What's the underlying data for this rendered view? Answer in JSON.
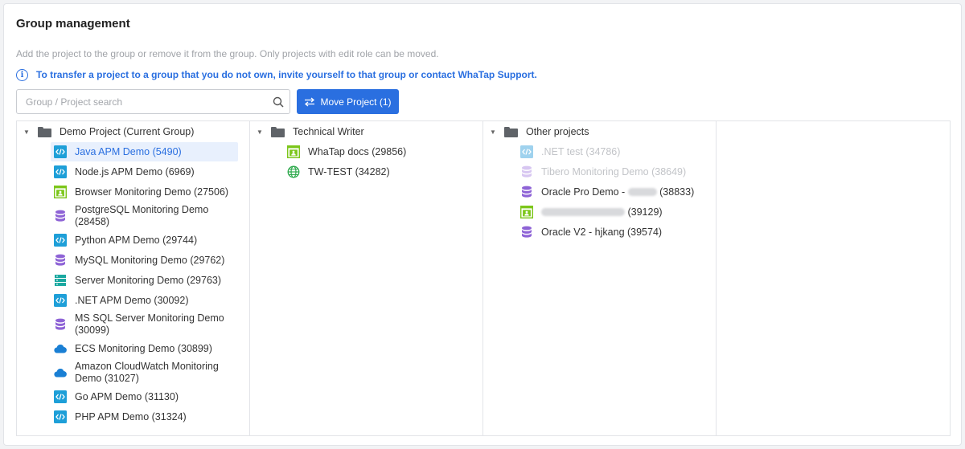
{
  "page": {
    "title": "Group management",
    "description": "Add the project to the group or remove it from the group. Only projects with edit role can be moved.",
    "info_text": "To transfer a project to a group that you do not own, invite yourself to that group or contact WhaTap Support."
  },
  "search": {
    "placeholder": "Group / Project search",
    "value": ""
  },
  "move_button": {
    "label": "Move Project (1)"
  },
  "colors": {
    "accent": "#2a6fe0",
    "apm": "#1e9fd8",
    "browser": "#7cc61a",
    "db": "#8e63d6",
    "server": "#1aa8a0",
    "cloud": "#1a7fd4"
  },
  "groups": [
    {
      "name": "Demo Project (Current Group)",
      "items": [
        {
          "label": "Java APM Demo (5490)",
          "icon": "apm-code-icon",
          "selected": true
        },
        {
          "label": "Node.js APM Demo (6969)",
          "icon": "apm-code-icon"
        },
        {
          "label": "Browser Monitoring Demo (27506)",
          "icon": "browser-monitoring-icon"
        },
        {
          "label": "PostgreSQL Monitoring Demo (28458)",
          "icon": "database-icon"
        },
        {
          "label": "Python APM Demo (29744)",
          "icon": "apm-code-icon"
        },
        {
          "label": "MySQL Monitoring Demo (29762)",
          "icon": "database-icon"
        },
        {
          "label": "Server Monitoring Demo (29763)",
          "icon": "server-icon"
        },
        {
          "label": ".NET APM Demo (30092)",
          "icon": "apm-code-icon"
        },
        {
          "label": "MS SQL Server Monitoring Demo (30099)",
          "icon": "database-icon"
        },
        {
          "label": "ECS Monitoring Demo (30899)",
          "icon": "cloud-icon"
        },
        {
          "label": "Amazon CloudWatch Monitoring Demo (31027)",
          "icon": "cloud-icon"
        },
        {
          "label": "Go APM Demo (31130)",
          "icon": "apm-code-icon"
        },
        {
          "label": "PHP APM Demo (31324)",
          "icon": "apm-code-icon"
        }
      ]
    },
    {
      "name": "Technical Writer",
      "items": [
        {
          "label": "WhaTap docs (29856)",
          "icon": "browser-monitoring-icon"
        },
        {
          "label": "TW-TEST (34282)",
          "icon": "globe-icon"
        }
      ]
    },
    {
      "name": "Other projects",
      "items": [
        {
          "label": ".NET test (34786)",
          "icon": "apm-code-icon",
          "disabled": true
        },
        {
          "label": "Tibero Monitoring Demo (38649)",
          "icon": "database-icon",
          "disabled": true
        },
        {
          "label": "Oracle Pro Demo - ",
          "suffix": " (38833)",
          "blurred": true,
          "icon": "database-icon"
        },
        {
          "label": "",
          "suffix": " (39129)",
          "blurred": true,
          "icon": "browser-monitoring-icon"
        },
        {
          "label": "Oracle V2 - hjkang (39574)",
          "icon": "database-icon"
        }
      ]
    }
  ]
}
